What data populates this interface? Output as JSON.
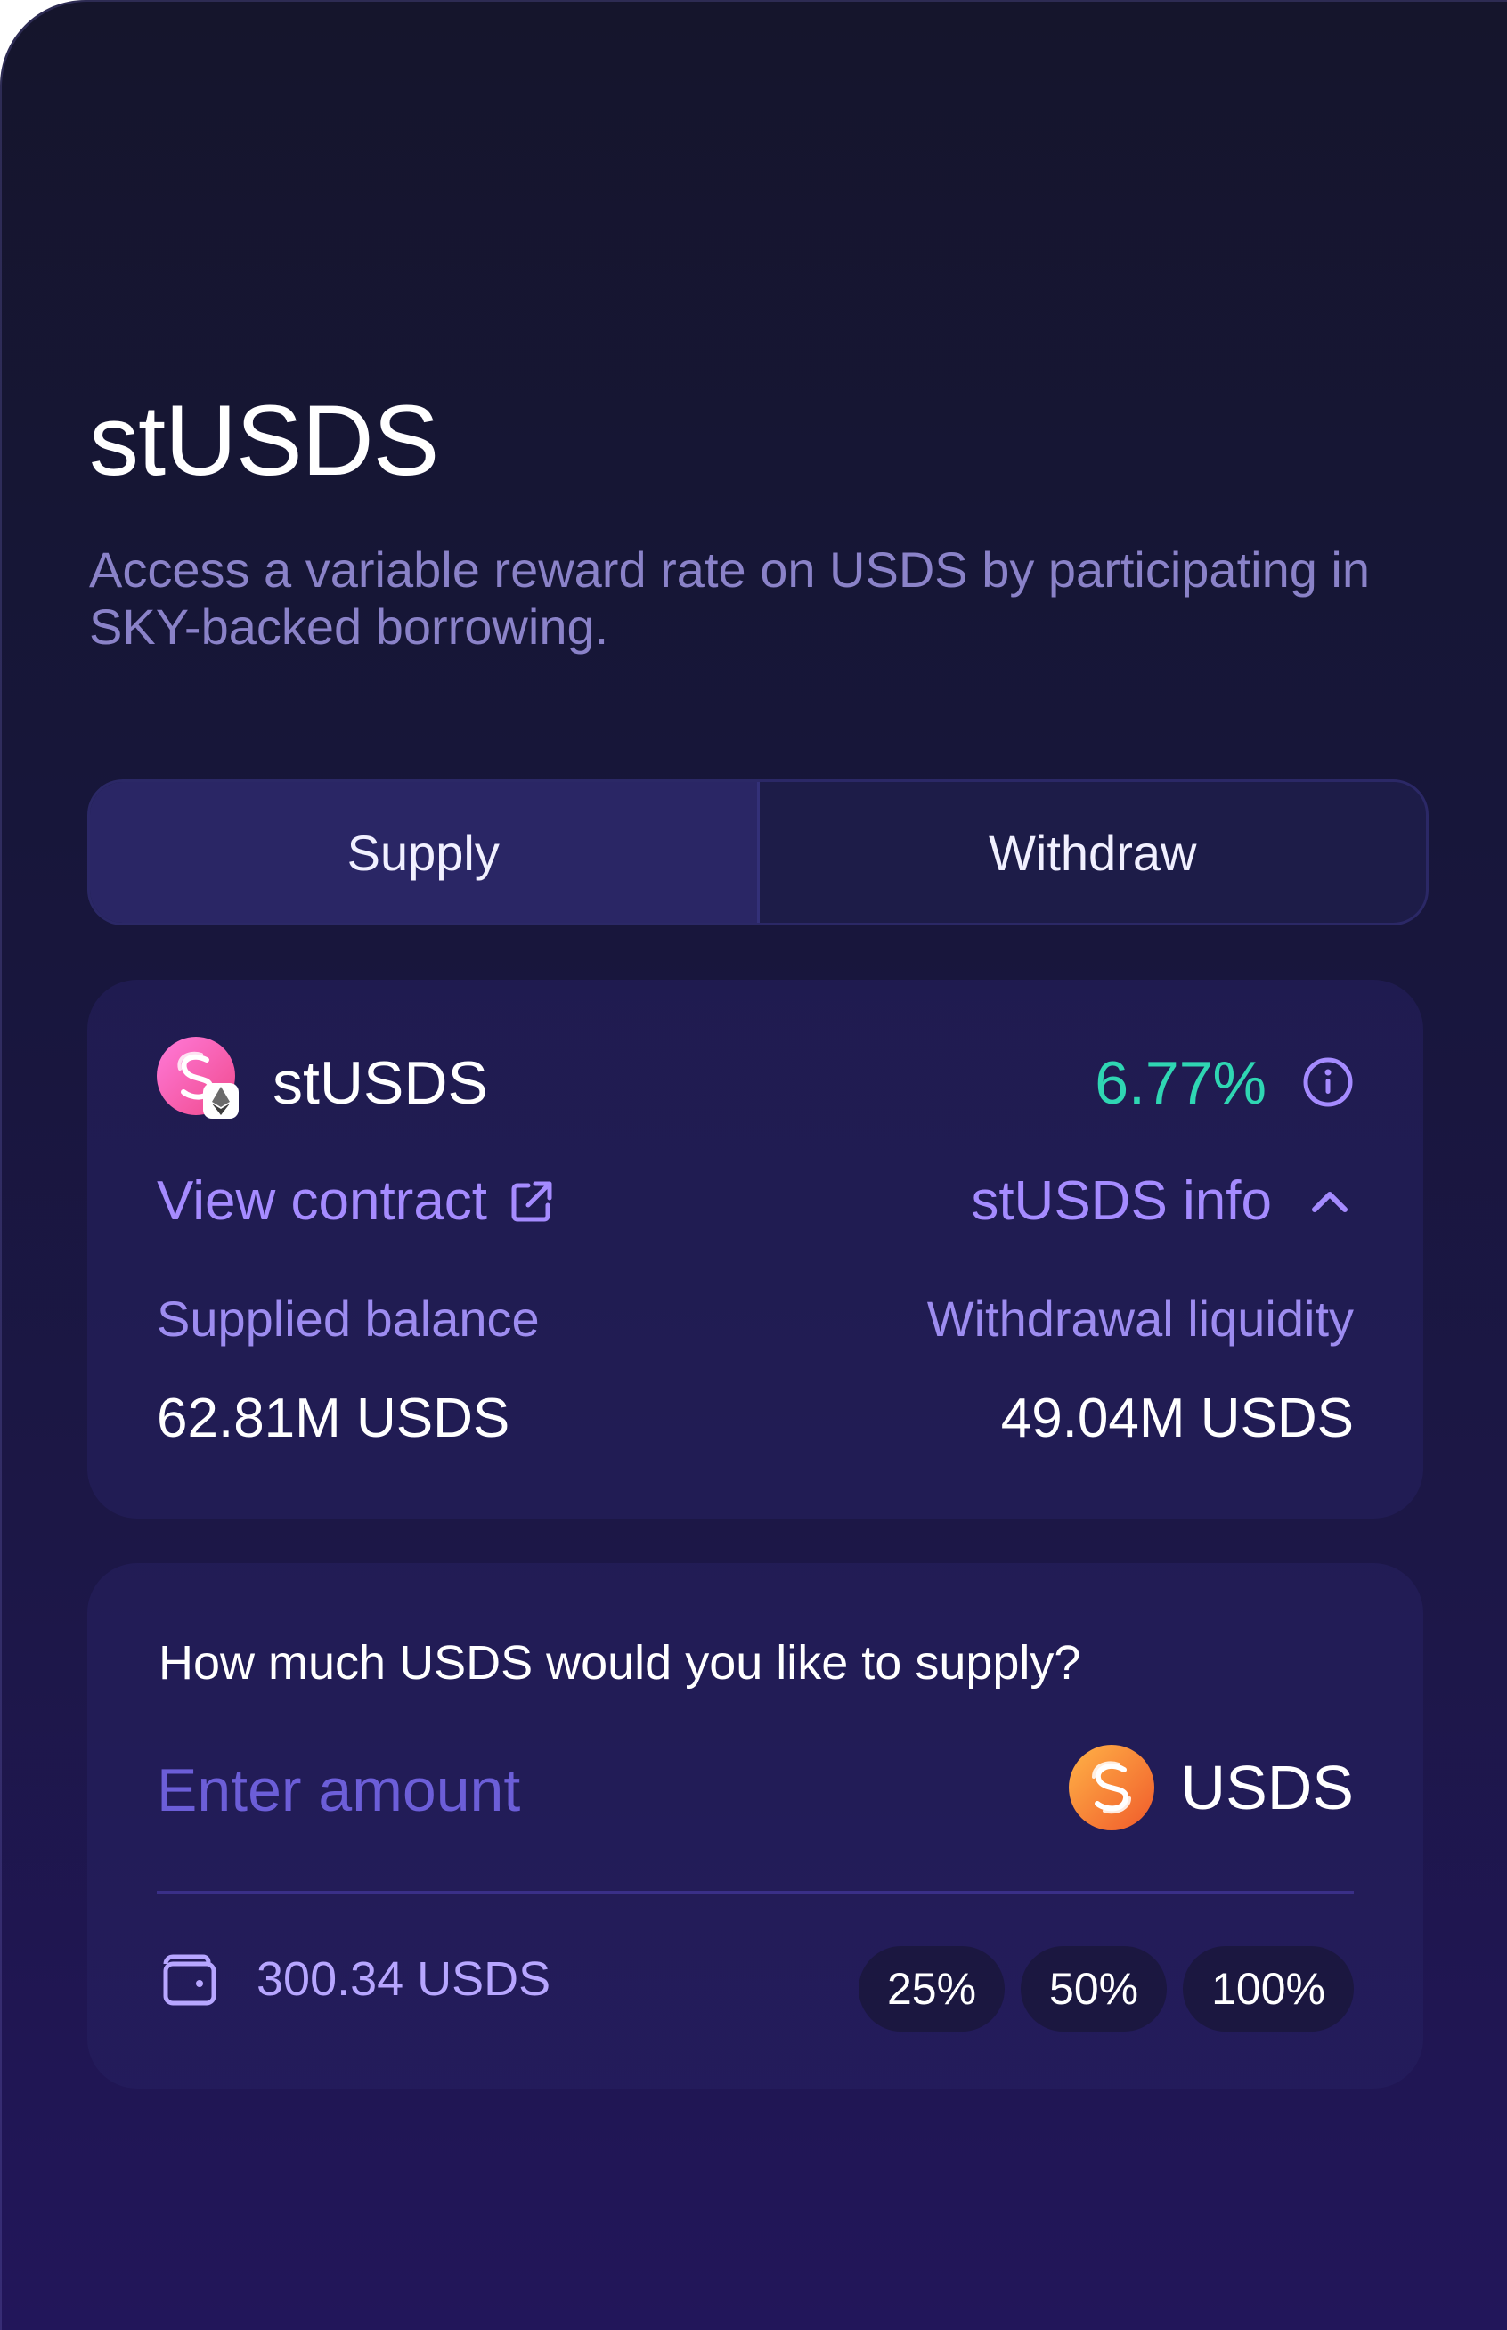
{
  "header": {
    "title": "stUSDS",
    "subtitle": "Access a variable reward rate on USDS by participating in SKY-backed borrowing."
  },
  "tabs": [
    {
      "label": "Supply",
      "active": true
    },
    {
      "label": "Withdraw",
      "active": false
    }
  ],
  "info_card": {
    "token_name": "stUSDS",
    "rate": "6.77%",
    "view_contract_label": "View contract",
    "info_toggle_label": "stUSDS info",
    "supplied_balance_label": "Supplied balance",
    "supplied_balance_value": "62.81M USDS",
    "withdrawal_liquidity_label": "Withdrawal liquidity",
    "withdrawal_liquidity_value": "49.04M USDS"
  },
  "supply_card": {
    "question": "How much USDS would you like to supply?",
    "amount_placeholder": "Enter amount",
    "token_label": "USDS",
    "wallet_balance": "300.34 USDS",
    "percent_options": [
      "25%",
      "50%",
      "100%"
    ]
  },
  "colors": {
    "accent": "#a58bff",
    "rate_positive": "#2fd6b3",
    "background_top": "#15152c",
    "background_bottom": "#22165a"
  }
}
